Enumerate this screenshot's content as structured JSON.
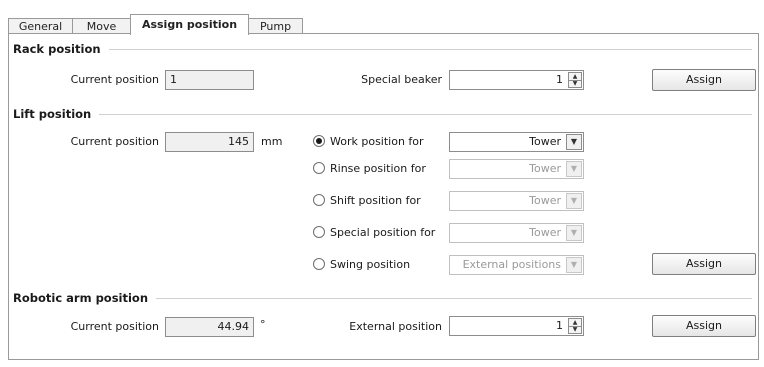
{
  "tabs": [
    "General",
    "Move",
    "Assign position",
    "Pump"
  ],
  "rack": {
    "title": "Rack position",
    "current_label": "Current position",
    "current_value": "1",
    "beaker_label": "Special beaker",
    "beaker_value": "1",
    "assign_label": "Assign"
  },
  "lift": {
    "title": "Lift position",
    "current_label": "Current position",
    "current_value": "145",
    "unit": "mm",
    "options": [
      {
        "label": "Work position for",
        "value": "Tower",
        "selected": true,
        "enabled": true
      },
      {
        "label": "Rinse position for",
        "value": "Tower",
        "selected": false,
        "enabled": false
      },
      {
        "label": "Shift position for",
        "value": "Tower",
        "selected": false,
        "enabled": false
      },
      {
        "label": "Special position for",
        "value": "Tower",
        "selected": false,
        "enabled": false
      },
      {
        "label": "Swing position",
        "value": "External positions",
        "selected": false,
        "enabled": false
      }
    ],
    "assign_label": "Assign"
  },
  "arm": {
    "title": "Robotic arm position",
    "current_label": "Current position",
    "current_value": "44.94",
    "unit": "°",
    "external_label": "External position",
    "external_value": "1",
    "assign_label": "Assign"
  }
}
